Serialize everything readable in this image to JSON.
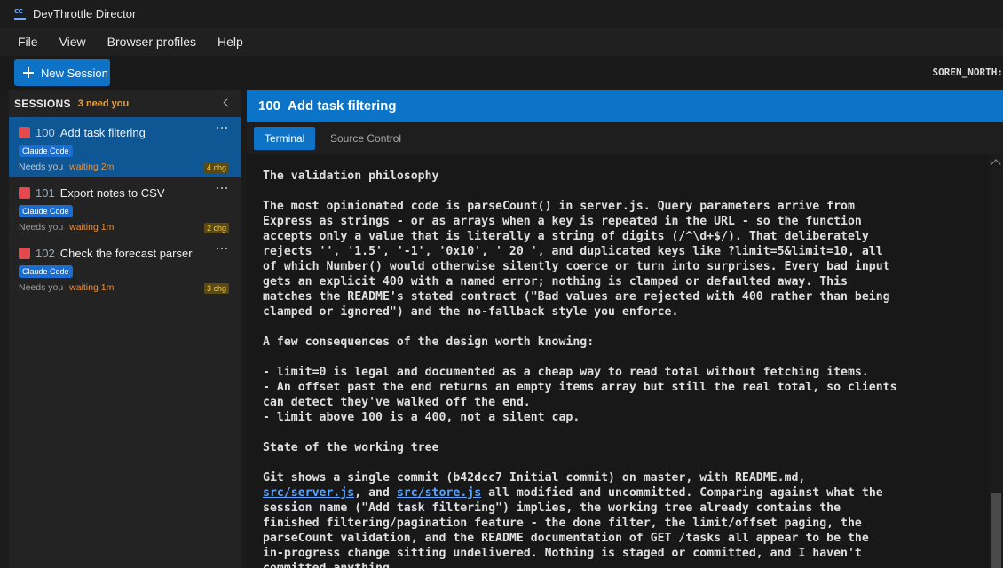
{
  "window": {
    "title": "DevThrottle Director",
    "icon_text": "CC"
  },
  "menu": [
    "File",
    "View",
    "Browser profiles",
    "Help"
  ],
  "toolbar": {
    "new_session_label": "New Session",
    "user": "SOREN_NORTH:"
  },
  "sidebar": {
    "header": "SESSIONS",
    "need_count": "3 need you",
    "sessions": [
      {
        "num": "100",
        "name": "Add task filtering",
        "agent": "Claude Code",
        "needs": "Needs you",
        "waiting": "waiting 2m",
        "changes": "4 chg",
        "selected": true
      },
      {
        "num": "101",
        "name": "Export notes to CSV",
        "agent": "Claude Code",
        "needs": "Needs you",
        "waiting": "waiting 1m",
        "changes": "2 chg",
        "selected": false
      },
      {
        "num": "102",
        "name": "Check the forecast parser",
        "agent": "Claude Code",
        "needs": "Needs you",
        "waiting": "waiting 1m",
        "changes": "3 chg",
        "selected": false
      }
    ]
  },
  "main": {
    "session_num": "100",
    "session_title": "Add task filtering",
    "tabs": [
      "Terminal",
      "Source Control"
    ],
    "terminal_lines": [
      [
        "The validation philosophy"
      ],
      [
        ""
      ],
      [
        "The most opinionated code is parseCount() in server.js. Query parameters arrive from"
      ],
      [
        "Express as strings - or as arrays when a key is repeated in the URL - so the function"
      ],
      [
        "accepts only a value that is literally a string of digits (/^\\d+$/). That deliberately"
      ],
      [
        "rejects '', '1.5', '-1', '0x10', ' 20 ', and duplicated keys like ?limit=5&limit=10, all"
      ],
      [
        "of which Number() would otherwise silently coerce or turn into surprises. Every bad input"
      ],
      [
        "gets an explicit 400 with a named error; nothing is clamped or defaulted away. This"
      ],
      [
        "matches the README's stated contract (\"Bad values are rejected with 400 rather than being"
      ],
      [
        "clamped or ignored\") and the no-fallback style you enforce."
      ],
      [
        ""
      ],
      [
        "A few consequences of the design worth knowing:"
      ],
      [
        ""
      ],
      [
        "- limit=0 is legal and documented as a cheap way to read total without fetching items."
      ],
      [
        "- An offset past the end returns an empty items array but still the real total, so clients"
      ],
      [
        "can detect they've walked off the end."
      ],
      [
        "- limit above 100 is a 400, not a silent cap."
      ],
      [
        ""
      ],
      [
        "State of the working tree"
      ],
      [
        ""
      ],
      [
        "Git shows a single commit (b42dcc7 Initial commit) on master, with README.md,"
      ],
      [
        {
          "link": "src/server.js"
        },
        ", and ",
        {
          "link": "src/store.js"
        },
        " all modified and uncommitted. Comparing against what the"
      ],
      [
        "session name (\"Add task filtering\") implies, the working tree already contains the"
      ],
      [
        "finished filtering/pagination feature - the done filter, the limit/offset paging, the"
      ],
      [
        "parseCount validation, and the README documentation of GET /tasks all appear to be the"
      ],
      [
        "in-progress change sitting undelivered. Nothing is staged or committed, and I haven't"
      ],
      [
        "committed anything."
      ]
    ]
  }
}
